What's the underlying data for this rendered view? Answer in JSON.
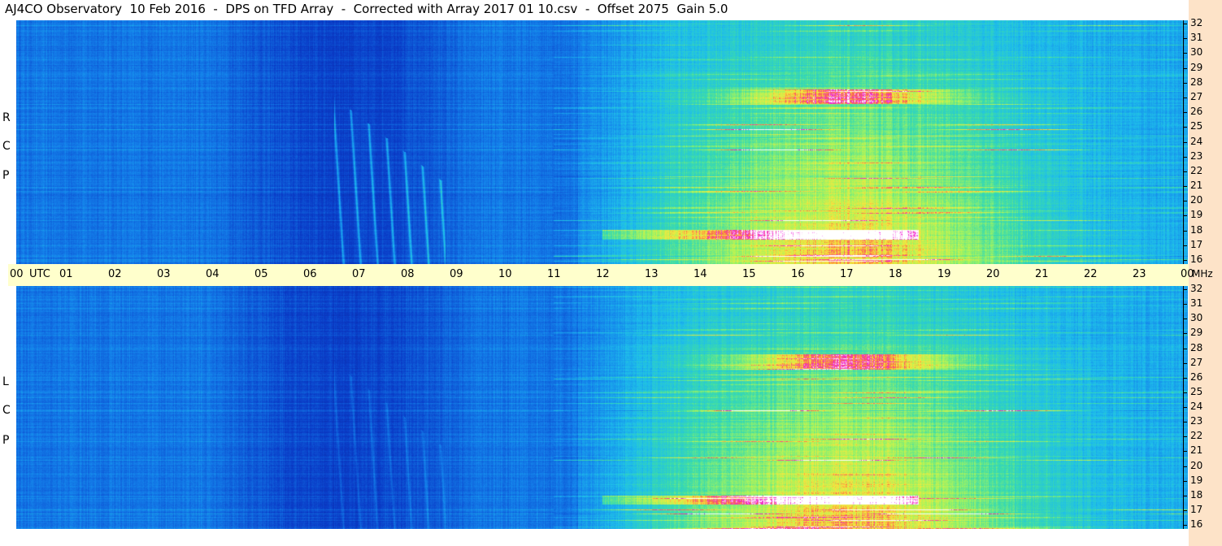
{
  "title": "AJ4CO Observatory  10 Feb 2016  -  DPS on TFD Array  -  Corrected with Array 2017 01 10.csv  -  Offset 2075  Gain 5.0",
  "chart_data": {
    "type": "heatmap",
    "panels": [
      {
        "name_letters": [
          "R",
          "C",
          "P"
        ]
      },
      {
        "name_letters": [
          "L",
          "C",
          "P"
        ]
      }
    ],
    "x_axis": {
      "label": "UTC",
      "range": [
        0,
        24
      ],
      "ticks": [
        "00",
        "01",
        "02",
        "03",
        "04",
        "05",
        "06",
        "07",
        "08",
        "09",
        "10",
        "11",
        "12",
        "13",
        "14",
        "15",
        "16",
        "17",
        "18",
        "19",
        "20",
        "21",
        "22",
        "23",
        "00"
      ]
    },
    "y_axis": {
      "unit": "MHz",
      "range": [
        16,
        32
      ],
      "ticks": [
        "32",
        "31",
        "30",
        "29",
        "28",
        "27",
        "26",
        "25",
        "24",
        "23",
        "22",
        "21",
        "20",
        "19",
        "18",
        "17",
        "16"
      ]
    },
    "features": {
      "daytime_hours": [
        12,
        24
      ],
      "peak_hour": 17,
      "bright_band_mhz": [
        26.5,
        27.5
      ],
      "bursts_hours": [
        6.5,
        8.8
      ]
    },
    "colors": {
      "low": "#0a2a9a",
      "mid": "#1e90ff",
      "high": "#7cfc00",
      "peak": "#ff00ff",
      "max": "#ffffff",
      "timebar": "#ffffcc",
      "axisbg": "#fde3c8"
    }
  }
}
